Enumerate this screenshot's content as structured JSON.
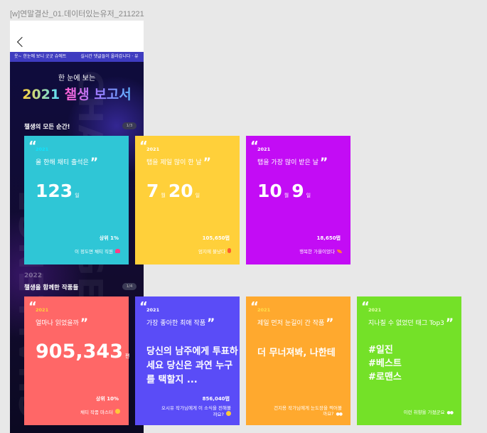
{
  "frame_label": "[w]연말결산_01.데이터있는유저_211221",
  "phone": {
    "ticker": [
      "웃~ 한눈에 보니 굿굿 슈에트",
      "실시간 댓글들이 올라갑니다 · 유"
    ],
    "subtitle": "한 눈에 보는",
    "title_year": "2021",
    "title_name": "챌생 보고서",
    "section1": "챌생의 모든 순간!",
    "section1_page": "1/3",
    "watermark": "CHALLENGE",
    "big_year": "2022",
    "section2": "챌생을 함께한 작품들",
    "section2_page": "1/4"
  },
  "cards": {
    "c1": {
      "year": "2021",
      "question": "올 한해 채티 출석은",
      "value": "123",
      "unit": "일",
      "stat": "상위 1%",
      "caption": "이 정도면 채티 직원"
    },
    "c2": {
      "year": "2021",
      "question": "탭을 제일 많이 한 날",
      "month": "7",
      "month_unit": "월",
      "day": "20",
      "day_unit": "일",
      "stat": "105,650탭",
      "caption": "엄지에 불났다"
    },
    "c3": {
      "year": "2021",
      "question": "탭을 가장 많이 받은 날",
      "month": "10",
      "month_unit": "월",
      "day": "9",
      "day_unit": "일",
      "stat": "18,650탭",
      "caption": "행복한 가을이었다"
    },
    "c4": {
      "year": "2021",
      "question": "얼마나 읽었을까",
      "value": "905,343",
      "unit": "편",
      "stat": "상위 10%",
      "caption": "채티 작품 마스터"
    },
    "c5": {
      "year": "2021",
      "question": "가장 좋아한 최애 작품",
      "long": "당신의 남주에게 투표하세요 당신은 과연 누구를 택할지 ...",
      "stat": "856,040탭",
      "caption1": "오시유 작가님에게 이 소식을 전해볼",
      "caption2": "까요?"
    },
    "c6": {
      "year": "2021",
      "question": "제일 먼저 눈길이 간 작품",
      "long": "더 무너져봐, 나한테",
      "caption1": "건지용 작가님에게 눈도장을 찍어볼",
      "caption2": "까요?"
    },
    "c7": {
      "year": "2021",
      "question": "지나칠 수 없었던 태그 Top3",
      "tags": [
        "#일진",
        "#베스트",
        "#로맨스"
      ],
      "caption": "이런 취향을 가졌군요"
    }
  }
}
